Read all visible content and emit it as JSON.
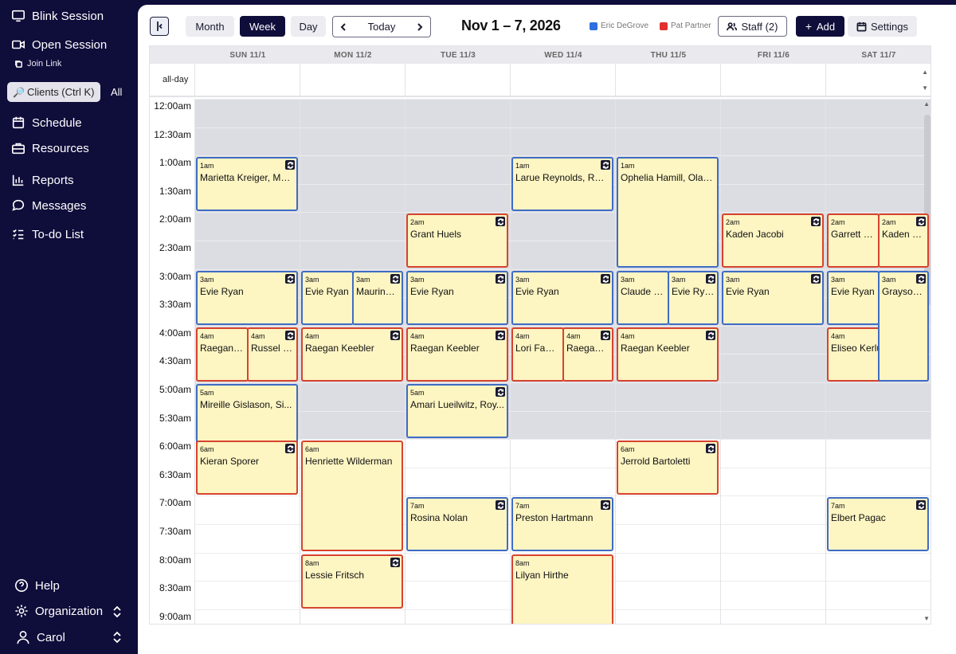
{
  "sidebar": {
    "blink_session": "Blink Session",
    "open_session": "Open Session",
    "join_link": "Join Link",
    "clients_search": "Clients (Ctrl K)",
    "all": "All",
    "nav": [
      "Schedule",
      "Resources",
      "Reports",
      "Messages",
      "To-do List"
    ],
    "help": "Help",
    "organization": "Organization",
    "user": "Carol"
  },
  "toolbar": {
    "views": [
      "Month",
      "Week",
      "Day"
    ],
    "active_view": "Week",
    "today": "Today",
    "date_range": "Nov 1 – 7, 2026",
    "legend": [
      {
        "name": "Eric DeGrove",
        "color": "#2f6fe0"
      },
      {
        "name": "Pat Partner",
        "color": "#e03030"
      }
    ],
    "staff": "Staff (2)",
    "add": "Add",
    "settings": "Settings"
  },
  "calendar": {
    "days": [
      "SUN 11/1",
      "MON 11/2",
      "TUE 11/3",
      "WED 11/4",
      "THU 11/5",
      "FRI 11/6",
      "SAT 11/7"
    ],
    "allday_label": "all-day",
    "times": [
      "12:00am",
      "12:30am",
      "1:00am",
      "1:30am",
      "2:00am",
      "2:30am",
      "3:00am",
      "3:30am",
      "4:00am",
      "4:30am",
      "5:00am",
      "5:30am",
      "6:00am",
      "6:30am",
      "7:00am",
      "7:30am",
      "8:00am",
      "8:30am",
      "9:00am"
    ],
    "events": [
      {
        "day": 0,
        "start": 2,
        "slots": 2,
        "time": "1am",
        "name": "Marietta Kreiger, Ma...",
        "color": "blue",
        "sub": 0,
        "nsub": 1,
        "recur": true
      },
      {
        "day": 3,
        "start": 2,
        "slots": 2,
        "time": "1am",
        "name": "Larue Reynolds, Rom...",
        "color": "blue",
        "sub": 0,
        "nsub": 1,
        "recur": true
      },
      {
        "day": 4,
        "start": 2,
        "slots": 4,
        "time": "1am",
        "name": "Ophelia Hamill, Olaf ...",
        "color": "blue",
        "sub": 0,
        "nsub": 1,
        "recur": false
      },
      {
        "day": 2,
        "start": 4,
        "slots": 2,
        "time": "2am",
        "name": "Grant Huels",
        "color": "red",
        "sub": 0,
        "nsub": 1,
        "recur": true
      },
      {
        "day": 5,
        "start": 4,
        "slots": 2,
        "time": "2am",
        "name": "Kaden Jacobi",
        "color": "red",
        "sub": 0,
        "nsub": 1,
        "recur": true
      },
      {
        "day": 6,
        "start": 4,
        "slots": 2,
        "time": "2am",
        "name": "Garrett Mo",
        "color": "red",
        "sub": 0,
        "nsub": 2,
        "recur": false
      },
      {
        "day": 6,
        "start": 4,
        "slots": 2,
        "time": "2am",
        "name": "Kaden Ja...",
        "color": "red",
        "sub": 1,
        "nsub": 2,
        "recur": true
      },
      {
        "day": 0,
        "start": 6,
        "slots": 2,
        "time": "3am",
        "name": "Evie Ryan",
        "color": "blue",
        "sub": 0,
        "nsub": 1,
        "recur": true
      },
      {
        "day": 1,
        "start": 6,
        "slots": 2,
        "time": "3am",
        "name": "Evie Ryan",
        "color": "blue",
        "sub": 0,
        "nsub": 2,
        "recur": false
      },
      {
        "day": 1,
        "start": 6,
        "slots": 2,
        "time": "3am",
        "name": "Maurine ...",
        "color": "blue",
        "sub": 1,
        "nsub": 2,
        "recur": true
      },
      {
        "day": 2,
        "start": 6,
        "slots": 2,
        "time": "3am",
        "name": "Evie Ryan",
        "color": "blue",
        "sub": 0,
        "nsub": 1,
        "recur": true
      },
      {
        "day": 3,
        "start": 6,
        "slots": 2,
        "time": "3am",
        "name": "Evie Ryan",
        "color": "blue",
        "sub": 0,
        "nsub": 1,
        "recur": true
      },
      {
        "day": 4,
        "start": 6,
        "slots": 2,
        "time": "3am",
        "name": "Claude Hay",
        "color": "blue",
        "sub": 0,
        "nsub": 2,
        "recur": false
      },
      {
        "day": 4,
        "start": 6,
        "slots": 2,
        "time": "3am",
        "name": "Evie Ryan",
        "color": "blue",
        "sub": 1,
        "nsub": 2,
        "recur": true
      },
      {
        "day": 5,
        "start": 6,
        "slots": 2,
        "time": "3am",
        "name": "Evie Ryan",
        "color": "blue",
        "sub": 0,
        "nsub": 1,
        "recur": true
      },
      {
        "day": 6,
        "start": 6,
        "slots": 2,
        "time": "3am",
        "name": "Evie Ryan",
        "color": "blue",
        "sub": 0,
        "nsub": 2,
        "recur": false
      },
      {
        "day": 6,
        "start": 6,
        "slots": 4,
        "time": "3am",
        "name": "Grayson ...",
        "color": "blue",
        "sub": 1,
        "nsub": 2,
        "recur": true
      },
      {
        "day": 0,
        "start": 8,
        "slots": 2,
        "time": "4am",
        "name": "Raegan Kee",
        "color": "red",
        "sub": 0,
        "nsub": 2,
        "recur": false
      },
      {
        "day": 0,
        "start": 8,
        "slots": 2,
        "time": "4am",
        "name": "Russel Hi...",
        "color": "red",
        "sub": 1,
        "nsub": 2,
        "recur": true
      },
      {
        "day": 1,
        "start": 8,
        "slots": 2,
        "time": "4am",
        "name": "Raegan Keebler",
        "color": "red",
        "sub": 0,
        "nsub": 1,
        "recur": true
      },
      {
        "day": 2,
        "start": 8,
        "slots": 2,
        "time": "4am",
        "name": "Raegan Keebler",
        "color": "red",
        "sub": 0,
        "nsub": 1,
        "recur": true
      },
      {
        "day": 3,
        "start": 8,
        "slots": 2,
        "time": "4am",
        "name": "Lori Fahey",
        "color": "red",
        "sub": 0,
        "nsub": 2,
        "recur": false
      },
      {
        "day": 3,
        "start": 8,
        "slots": 2,
        "time": "4am",
        "name": "Raegan K...",
        "color": "red",
        "sub": 1,
        "nsub": 2,
        "recur": true
      },
      {
        "day": 4,
        "start": 8,
        "slots": 2,
        "time": "4am",
        "name": "Raegan Keebler",
        "color": "red",
        "sub": 0,
        "nsub": 1,
        "recur": true
      },
      {
        "day": 6,
        "start": 8,
        "slots": 2,
        "time": "4am",
        "name": "Eliseo Kerluke",
        "color": "red",
        "sub": 0,
        "nsub": 1,
        "recur": true
      },
      {
        "day": 0,
        "start": 10,
        "slots": 4,
        "time": "5am",
        "name": "Mireille Gislason, Si...",
        "color": "blue",
        "sub": 0,
        "nsub": 1,
        "recur": false
      },
      {
        "day": 2,
        "start": 10,
        "slots": 2,
        "time": "5am",
        "name": "Amari Lueilwitz, Roy...",
        "color": "blue",
        "sub": 0,
        "nsub": 1,
        "recur": true
      },
      {
        "day": 0,
        "start": 12,
        "slots": 2,
        "time": "6am",
        "name": "Kieran Sporer",
        "color": "red",
        "sub": 0,
        "nsub": 1,
        "recur": true
      },
      {
        "day": 1,
        "start": 12,
        "slots": 4,
        "time": "6am",
        "name": "Henriette Wilderman",
        "color": "red",
        "sub": 0,
        "nsub": 1,
        "recur": false
      },
      {
        "day": 4,
        "start": 12,
        "slots": 2,
        "time": "6am",
        "name": "Jerrold Bartoletti",
        "color": "red",
        "sub": 0,
        "nsub": 1,
        "recur": true
      },
      {
        "day": 2,
        "start": 14,
        "slots": 2,
        "time": "7am",
        "name": "Rosina Nolan",
        "color": "blue",
        "sub": 0,
        "nsub": 1,
        "recur": true
      },
      {
        "day": 3,
        "start": 14,
        "slots": 2,
        "time": "7am",
        "name": "Preston Hartmann",
        "color": "blue",
        "sub": 0,
        "nsub": 1,
        "recur": true
      },
      {
        "day": 6,
        "start": 14,
        "slots": 2,
        "time": "7am",
        "name": "Elbert Pagac",
        "color": "blue",
        "sub": 0,
        "nsub": 1,
        "recur": true
      },
      {
        "day": 1,
        "start": 16,
        "slots": 2,
        "time": "8am",
        "name": "Lessie Fritsch",
        "color": "red",
        "sub": 0,
        "nsub": 1,
        "recur": true
      },
      {
        "day": 3,
        "start": 16,
        "slots": 4,
        "time": "8am",
        "name": "Lilyan Hirthe",
        "color": "red",
        "sub": 0,
        "nsub": 1,
        "recur": false
      }
    ]
  }
}
